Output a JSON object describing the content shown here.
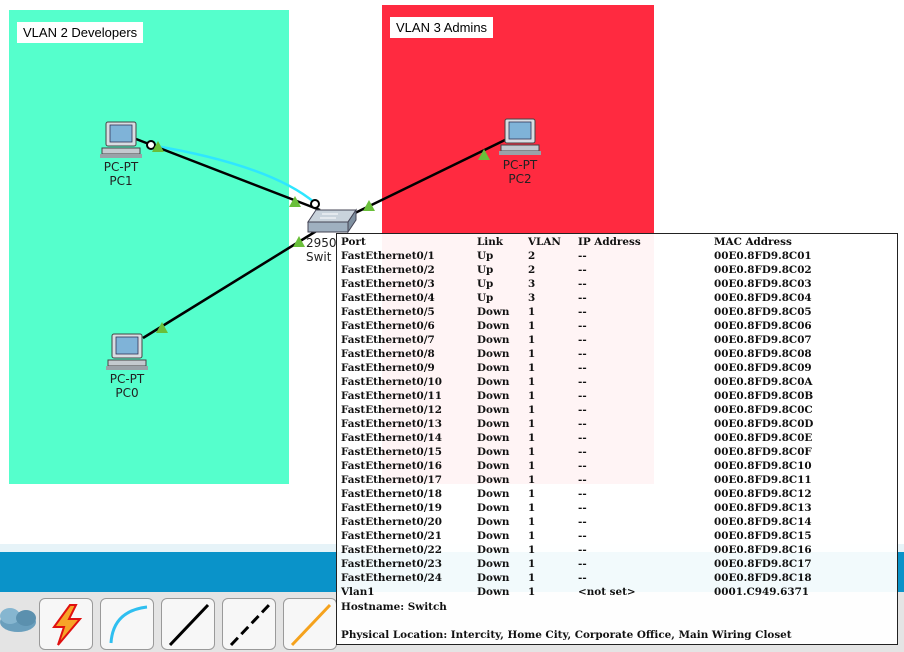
{
  "vlans": [
    {
      "label": "VLAN 2 Developers",
      "color": "#55ffcc"
    },
    {
      "label": "VLAN 3 Admins",
      "color": "#ff2a40"
    }
  ],
  "devices": {
    "pc1": {
      "model": "PC-PT",
      "name": "PC1"
    },
    "pc2": {
      "model": "PC-PT",
      "name": "PC2"
    },
    "pc0": {
      "model": "PC-PT",
      "name": "PC0"
    },
    "switch": {
      "model_partial": "2950",
      "name_partial": "Swit"
    }
  },
  "colors": {
    "link_up": "#6abf3a",
    "cable": "#000000",
    "console_cable": "#2fe6ff",
    "band": "#0a93c9"
  },
  "toolbar": {
    "tools": [
      {
        "icon": "cloud-icon"
      },
      {
        "icon": "lightning-auto-connect-icon"
      },
      {
        "icon": "console-cable-icon"
      },
      {
        "icon": "straight-through-cable-icon"
      },
      {
        "icon": "crossover-cable-icon"
      },
      {
        "icon": "fiber-cable-icon"
      }
    ]
  },
  "port_table": {
    "headers": {
      "port": "Port",
      "link": "Link",
      "vlan": "VLAN",
      "ip": "IP Address",
      "mac": "MAC Address"
    },
    "rows": [
      {
        "port": "FastEthernet0/1",
        "link": "Up",
        "vlan": "2",
        "ip": "--",
        "mac": "00E0.8FD9.8C01"
      },
      {
        "port": "FastEthernet0/2",
        "link": "Up",
        "vlan": "2",
        "ip": "--",
        "mac": "00E0.8FD9.8C02"
      },
      {
        "port": "FastEthernet0/3",
        "link": "Up",
        "vlan": "3",
        "ip": "--",
        "mac": "00E0.8FD9.8C03"
      },
      {
        "port": "FastEthernet0/4",
        "link": "Up",
        "vlan": "3",
        "ip": "--",
        "mac": "00E0.8FD9.8C04"
      },
      {
        "port": "FastEthernet0/5",
        "link": "Down",
        "vlan": "1",
        "ip": "--",
        "mac": "00E0.8FD9.8C05"
      },
      {
        "port": "FastEthernet0/6",
        "link": "Down",
        "vlan": "1",
        "ip": "--",
        "mac": "00E0.8FD9.8C06"
      },
      {
        "port": "FastEthernet0/7",
        "link": "Down",
        "vlan": "1",
        "ip": "--",
        "mac": "00E0.8FD9.8C07"
      },
      {
        "port": "FastEthernet0/8",
        "link": "Down",
        "vlan": "1",
        "ip": "--",
        "mac": "00E0.8FD9.8C08"
      },
      {
        "port": "FastEthernet0/9",
        "link": "Down",
        "vlan": "1",
        "ip": "--",
        "mac": "00E0.8FD9.8C09"
      },
      {
        "port": "FastEthernet0/10",
        "link": "Down",
        "vlan": "1",
        "ip": "--",
        "mac": "00E0.8FD9.8C0A"
      },
      {
        "port": "FastEthernet0/11",
        "link": "Down",
        "vlan": "1",
        "ip": "--",
        "mac": "00E0.8FD9.8C0B"
      },
      {
        "port": "FastEthernet0/12",
        "link": "Down",
        "vlan": "1",
        "ip": "--",
        "mac": "00E0.8FD9.8C0C"
      },
      {
        "port": "FastEthernet0/13",
        "link": "Down",
        "vlan": "1",
        "ip": "--",
        "mac": "00E0.8FD9.8C0D"
      },
      {
        "port": "FastEthernet0/14",
        "link": "Down",
        "vlan": "1",
        "ip": "--",
        "mac": "00E0.8FD9.8C0E"
      },
      {
        "port": "FastEthernet0/15",
        "link": "Down",
        "vlan": "1",
        "ip": "--",
        "mac": "00E0.8FD9.8C0F"
      },
      {
        "port": "FastEthernet0/16",
        "link": "Down",
        "vlan": "1",
        "ip": "--",
        "mac": "00E0.8FD9.8C10"
      },
      {
        "port": "FastEthernet0/17",
        "link": "Down",
        "vlan": "1",
        "ip": "--",
        "mac": "00E0.8FD9.8C11"
      },
      {
        "port": "FastEthernet0/18",
        "link": "Down",
        "vlan": "1",
        "ip": "--",
        "mac": "00E0.8FD9.8C12"
      },
      {
        "port": "FastEthernet0/19",
        "link": "Down",
        "vlan": "1",
        "ip": "--",
        "mac": "00E0.8FD9.8C13"
      },
      {
        "port": "FastEthernet0/20",
        "link": "Down",
        "vlan": "1",
        "ip": "--",
        "mac": "00E0.8FD9.8C14"
      },
      {
        "port": "FastEthernet0/21",
        "link": "Down",
        "vlan": "1",
        "ip": "--",
        "mac": "00E0.8FD9.8C15"
      },
      {
        "port": "FastEthernet0/22",
        "link": "Down",
        "vlan": "1",
        "ip": "--",
        "mac": "00E0.8FD9.8C16"
      },
      {
        "port": "FastEthernet0/23",
        "link": "Down",
        "vlan": "1",
        "ip": "--",
        "mac": "00E0.8FD9.8C17"
      },
      {
        "port": "FastEthernet0/24",
        "link": "Down",
        "vlan": "1",
        "ip": "--",
        "mac": "00E0.8FD9.8C18"
      },
      {
        "port": "Vlan1",
        "link": "Down",
        "vlan": "1",
        "ip": "<not set>",
        "mac": "0001.C949.6371"
      }
    ],
    "hostname": "Hostname: Switch",
    "location": "Physical Location: Intercity, Home City, Corporate Office, Main Wiring Closet"
  }
}
